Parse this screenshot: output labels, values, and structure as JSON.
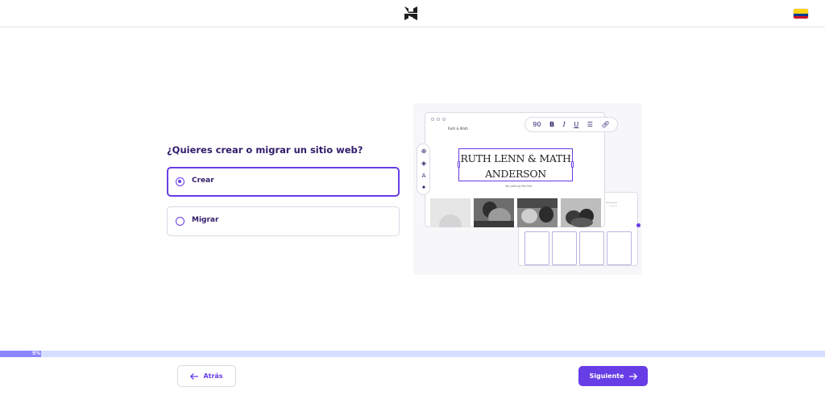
{
  "header": {
    "logo_icon": "hostinger-logo-icon",
    "language_flag_icon": "colombia-flag-icon",
    "flag_colors": [
      "#fcd116",
      "#003893",
      "#ce1126"
    ]
  },
  "main": {
    "question": "¿Quieres crear o migrar un sitio web?",
    "options": [
      {
        "label": "Crear",
        "selected": true
      },
      {
        "label": "Migrar",
        "selected": false
      }
    ]
  },
  "illustration": {
    "site_brand": "Ruth & Math",
    "title_line1": "RUTH LENN & MATH",
    "title_line2": "ANDERSON",
    "tagline": "We getting Married",
    "toolbar": {
      "font_size": "90",
      "bold": "B",
      "italic": "I",
      "underline": "U",
      "list_icon": "list-icon",
      "link_icon": "link-icon"
    },
    "side_tools": [
      "add-icon",
      "layers-icon",
      "text-style-icon",
      "ai-sparkle-icon"
    ]
  },
  "progress": {
    "percent_value": 5,
    "label": "5%"
  },
  "footer": {
    "back_label": "Atrás",
    "next_label": "Siguiente"
  },
  "colors": {
    "accent": "#673de6",
    "text_primary": "#2f1c6a",
    "progress_track": "#d5dfff",
    "progress_fill": "#8c85ff"
  }
}
